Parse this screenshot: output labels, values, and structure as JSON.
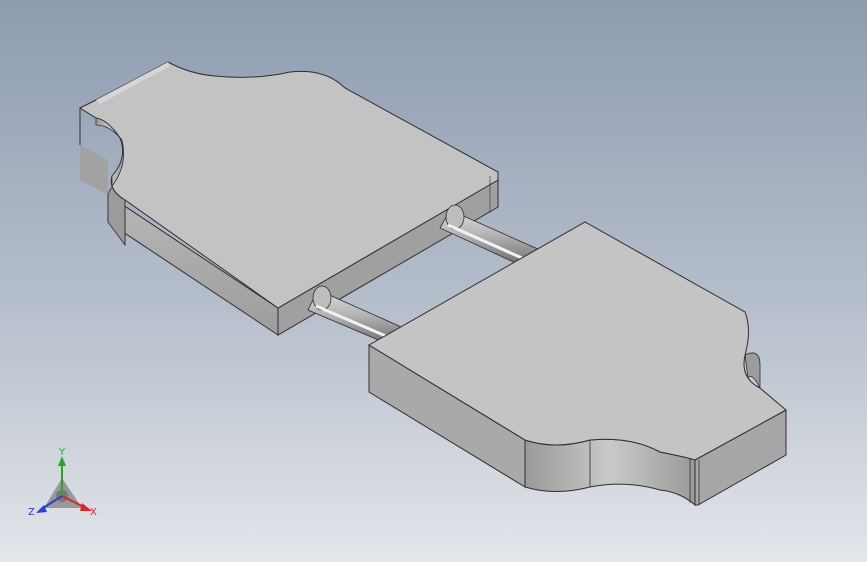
{
  "viewport": {
    "background_top": "#8e9bb0",
    "background_bottom": "#e3e6ea"
  },
  "model": {
    "face_top_color": "#c3c3c3",
    "face_side_color": "#a9a9a9",
    "face_dark_color": "#8a8a8a",
    "edge_color": "#2e2e2e"
  },
  "triad": {
    "axis_y": {
      "label": "Y",
      "color": "#2aa52a"
    },
    "axis_x": {
      "label": "X",
      "color": "#d42a2a"
    },
    "axis_z": {
      "label": "Z",
      "color": "#2a3fd4"
    }
  }
}
